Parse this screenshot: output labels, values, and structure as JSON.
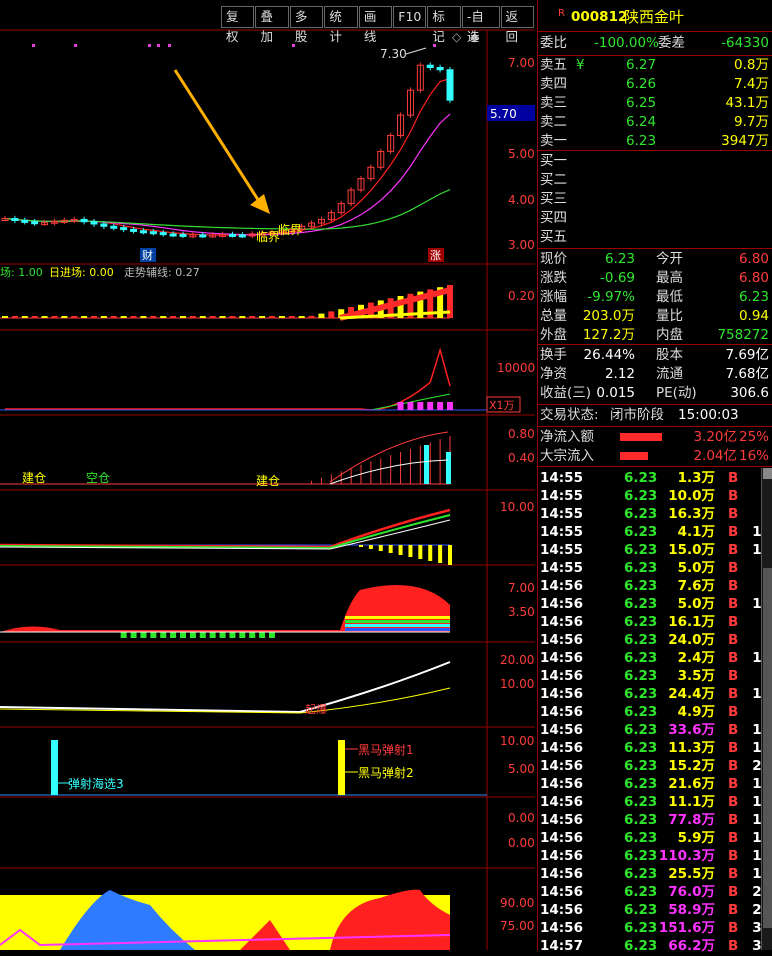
{
  "toolbar": {
    "buttons": [
      "复权",
      "叠加",
      "多股",
      "统计",
      "画线",
      "F10",
      "标记",
      "-自选",
      "返回"
    ]
  },
  "header": {
    "stock_code": "000812",
    "stock_name": "陕西金叶",
    "code_prefix": "R"
  },
  "chart_data": [
    {
      "type": "candlestick",
      "title": "",
      "y_ticks": [
        "7.00",
        "6.00",
        "5.00",
        "4.00",
        "3.00"
      ],
      "ylim": [
        2.75,
        7.6
      ],
      "current_price_label": "5.70",
      "high_label": "7.30",
      "annotations": [
        "临界",
        "临界",
        "财",
        "涨"
      ],
      "close_series": [
        3.62,
        3.58,
        3.55,
        3.52,
        3.53,
        3.56,
        3.58,
        3.6,
        3.55,
        3.5,
        3.45,
        3.42,
        3.38,
        3.35,
        3.33,
        3.31,
        3.28,
        3.27,
        3.25,
        3.26,
        3.25,
        3.26,
        3.27,
        3.26,
        3.25,
        3.28,
        3.3,
        3.32,
        3.35,
        3.38,
        3.45,
        3.52,
        3.6,
        3.75,
        3.95,
        4.25,
        4.5,
        4.75,
        5.1,
        5.45,
        5.9,
        6.45,
        7.0,
        6.95,
        6.9,
        6.23
      ]
    },
    {
      "type": "bar",
      "title": "",
      "legend": [
        "场: 1.00",
        "日进场: 0.00",
        "走势辅线: 0.27"
      ],
      "y_ticks": [
        "0.20"
      ],
      "ylim": [
        0,
        0.35
      ]
    },
    {
      "type": "line",
      "title": "",
      "y_ticks": [
        "10000"
      ],
      "unit_label": "X1万",
      "ylim": [
        0,
        20000
      ]
    },
    {
      "type": "bar",
      "title": "",
      "y_ticks": [
        "0.80",
        "0.40"
      ],
      "annotations": [
        "建仓",
        "空仓",
        "建仓"
      ],
      "ylim": [
        0,
        1.0
      ]
    },
    {
      "type": "bar",
      "title": "",
      "y_ticks": [
        "10.00"
      ],
      "ylim": [
        -5,
        12
      ]
    },
    {
      "type": "bar",
      "title": "",
      "y_ticks": [
        "7.00",
        "3.50"
      ],
      "ylim": [
        0,
        9
      ]
    },
    {
      "type": "line",
      "title": "",
      "y_ticks": [
        "20.00",
        "10.00"
      ],
      "annotations": [
        "起爆"
      ],
      "ylim": [
        0,
        24
      ]
    },
    {
      "type": "bar",
      "title": "",
      "y_ticks": [
        "10.00",
        "5.00"
      ],
      "annotations": [
        "弹射海选3",
        "黑马弹射1",
        "黑马弹射2"
      ],
      "ylim": [
        0,
        12
      ]
    },
    {
      "type": "line",
      "title": "",
      "y_ticks": [
        "0.00",
        "0.00"
      ],
      "ylim": [
        -1,
        1
      ]
    },
    {
      "type": "area",
      "title": "",
      "y_ticks": [
        "90.00",
        "75.00"
      ],
      "ylim": [
        65,
        100
      ]
    }
  ],
  "quote": {
    "weibi_label": "委比",
    "weibi": "-100.00%",
    "weicha_label": "委差",
    "weicha": "-64330",
    "asks": [
      {
        "label": "卖五",
        "extra": "¥",
        "price": "6.27",
        "vol": "0.8万"
      },
      {
        "label": "卖四",
        "extra": "",
        "price": "6.26",
        "vol": "7.4万"
      },
      {
        "label": "卖三",
        "extra": "",
        "price": "6.25",
        "vol": "43.1万"
      },
      {
        "label": "卖二",
        "extra": "",
        "price": "6.24",
        "vol": "9.7万"
      },
      {
        "label": "卖一",
        "extra": "",
        "price": "6.23",
        "vol": "3947万"
      }
    ],
    "bids": [
      "买一",
      "买二",
      "买三",
      "买四",
      "买五"
    ],
    "stats": [
      {
        "l": "现价",
        "v": "6.23",
        "l2": "今开",
        "v2": "6.80"
      },
      {
        "l": "涨跌",
        "v": "-0.69",
        "l2": "最高",
        "v2": "6.80"
      },
      {
        "l": "涨幅",
        "v": "-9.97%",
        "l2": "最低",
        "v2": "6.23"
      },
      {
        "l": "总量",
        "v": "203.0万",
        "l2": "量比",
        "v2": "0.94"
      },
      {
        "l": "外盘",
        "v": "127.2万",
        "l2": "内盘",
        "v2": "758272"
      }
    ],
    "stats2": [
      {
        "l": "换手",
        "v": "26.44%",
        "l2": "股本",
        "v2": "7.69亿"
      },
      {
        "l": "净资",
        "v": "2.12",
        "l2": "流通",
        "v2": "7.68亿"
      },
      {
        "l": "收益(三)",
        "v": "0.015",
        "l2": "PE(动)",
        "v2": "306.6"
      }
    ],
    "trade_status_label": "交易状态:",
    "trade_status": "闭市阶段",
    "trade_time": "15:00:03",
    "flow": [
      {
        "label": "净流入额",
        "value": "3.20亿",
        "pct": "25%"
      },
      {
        "label": "大宗流入",
        "value": "2.04亿",
        "pct": "16%"
      }
    ]
  },
  "ticks": [
    {
      "t": "14:55",
      "p": "6.23",
      "v": "1.3万",
      "s": "B",
      "n": "6"
    },
    {
      "t": "14:55",
      "p": "6.23",
      "v": "10.0万",
      "s": "B",
      "n": "6"
    },
    {
      "t": "14:55",
      "p": "6.23",
      "v": "16.3万",
      "s": "B",
      "n": "6"
    },
    {
      "t": "14:55",
      "p": "6.23",
      "v": "4.1万",
      "s": "B",
      "n": "12"
    },
    {
      "t": "14:55",
      "p": "6.23",
      "v": "15.0万",
      "s": "B",
      "n": "13"
    },
    {
      "t": "14:55",
      "p": "6.23",
      "v": "5.0万",
      "s": "B",
      "n": "5"
    },
    {
      "t": "14:56",
      "p": "6.23",
      "v": "7.6万",
      "s": "B",
      "n": "7"
    },
    {
      "t": "14:56",
      "p": "6.23",
      "v": "5.0万",
      "s": "B",
      "n": "10"
    },
    {
      "t": "14:56",
      "p": "6.23",
      "v": "16.1万",
      "s": "B",
      "n": "9"
    },
    {
      "t": "14:56",
      "p": "6.23",
      "v": "24.0万",
      "s": "B",
      "n": "6"
    },
    {
      "t": "14:56",
      "p": "6.23",
      "v": "2.4万",
      "s": "B",
      "n": "11"
    },
    {
      "t": "14:56",
      "p": "6.23",
      "v": "3.5万",
      "s": "B",
      "n": "7"
    },
    {
      "t": "14:56",
      "p": "6.23",
      "v": "24.4万",
      "s": "B",
      "n": "14"
    },
    {
      "t": "14:56",
      "p": "6.23",
      "v": "4.9万",
      "s": "B",
      "n": "8"
    },
    {
      "t": "14:56",
      "p": "6.23",
      "v": "33.6万",
      "s": "B",
      "n": "16"
    },
    {
      "t": "14:56",
      "p": "6.23",
      "v": "11.3万",
      "s": "B",
      "n": "16"
    },
    {
      "t": "14:56",
      "p": "6.23",
      "v": "15.2万",
      "s": "B",
      "n": "20"
    },
    {
      "t": "14:56",
      "p": "6.23",
      "v": "21.6万",
      "s": "B",
      "n": "12"
    },
    {
      "t": "14:56",
      "p": "6.23",
      "v": "11.1万",
      "s": "B",
      "n": "17"
    },
    {
      "t": "14:56",
      "p": "6.23",
      "v": "77.8万",
      "s": "B",
      "n": "15"
    },
    {
      "t": "14:56",
      "p": "6.23",
      "v": "5.9万",
      "s": "B",
      "n": "10"
    },
    {
      "t": "14:56",
      "p": "6.23",
      "v": "110.3万",
      "s": "B",
      "n": "17"
    },
    {
      "t": "14:56",
      "p": "6.23",
      "v": "25.5万",
      "s": "B",
      "n": "17"
    },
    {
      "t": "14:56",
      "p": "6.23",
      "v": "76.0万",
      "s": "B",
      "n": "22"
    },
    {
      "t": "14:56",
      "p": "6.23",
      "v": "58.9万",
      "s": "B",
      "n": "25"
    },
    {
      "t": "14:56",
      "p": "6.23",
      "v": "151.6万",
      "s": "B",
      "n": "34"
    },
    {
      "t": "14:57",
      "p": "6.23",
      "v": "66.2万",
      "s": "B",
      "n": "35"
    }
  ],
  "colors": {
    "up": "#ff3b3b",
    "down": "#33ffff",
    "ma_red": "#ff2020",
    "ma_mag": "#ff33ff",
    "ma_green": "#33dd33",
    "border": "#9a0000",
    "yellow": "#ffff00"
  }
}
